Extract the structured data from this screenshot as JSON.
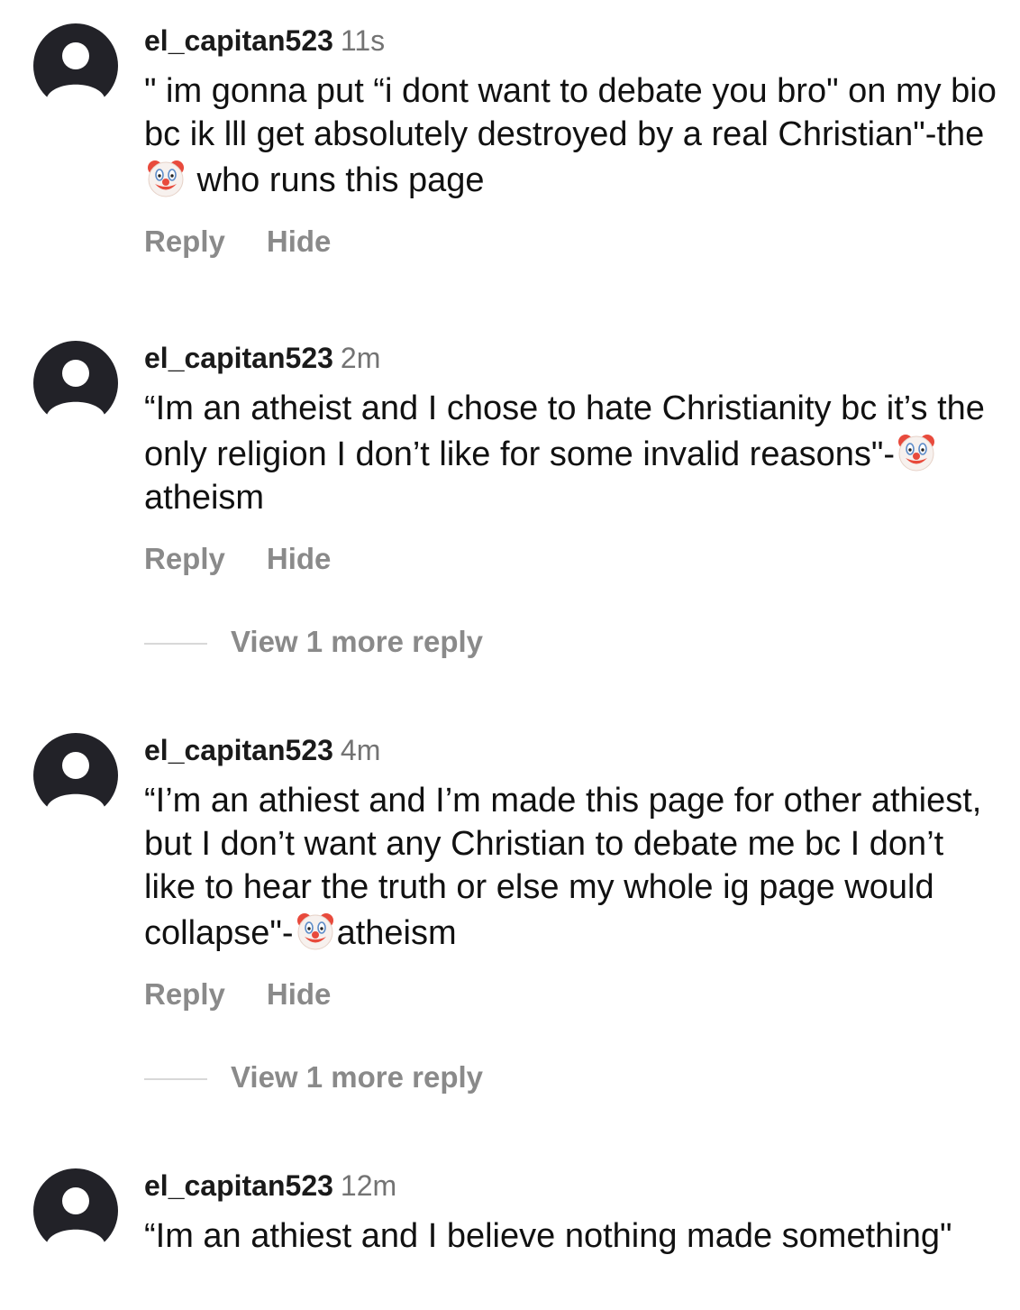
{
  "comments": [
    {
      "username": "el_capitan523",
      "time": "11s",
      "text_before": "\" im gonna put “i dont want to debate you bro\" on my bio bc ik lll get absolutely destroyed by a real Christian\"-the",
      "emoji": "clown-face",
      "text_after": " who runs this page",
      "reply_label": "Reply",
      "hide_label": "Hide"
    },
    {
      "username": "el_capitan523",
      "time": "2m",
      "text_before": "“Im an atheist and I chose to hate Christianity bc it’s the only religion I don’t like for some invalid reasons\"-",
      "emoji": "clown-face",
      "text_after": "atheism",
      "reply_label": "Reply",
      "hide_label": "Hide",
      "more_replies": "View 1 more reply"
    },
    {
      "username": "el_capitan523",
      "time": "4m",
      "text_before": "“I’m an athiest and I’m made this page for other athiest, but I don’t want any Christian to debate me bc I don’t like to hear the truth or else my whole ig page would collapse\"-",
      "emoji": "clown-face",
      "text_after": "atheism",
      "reply_label": "Reply",
      "hide_label": "Hide",
      "more_replies": "View 1 more reply"
    },
    {
      "username": "el_capitan523",
      "time": "12m",
      "text_before": "“Im an athiest and I believe nothing made something\"",
      "emoji": "",
      "text_after": ""
    }
  ],
  "colors": {
    "avatar": "#222228",
    "username": "#1a1a1a",
    "muted": "#8a8a8a",
    "time": "#737373"
  }
}
